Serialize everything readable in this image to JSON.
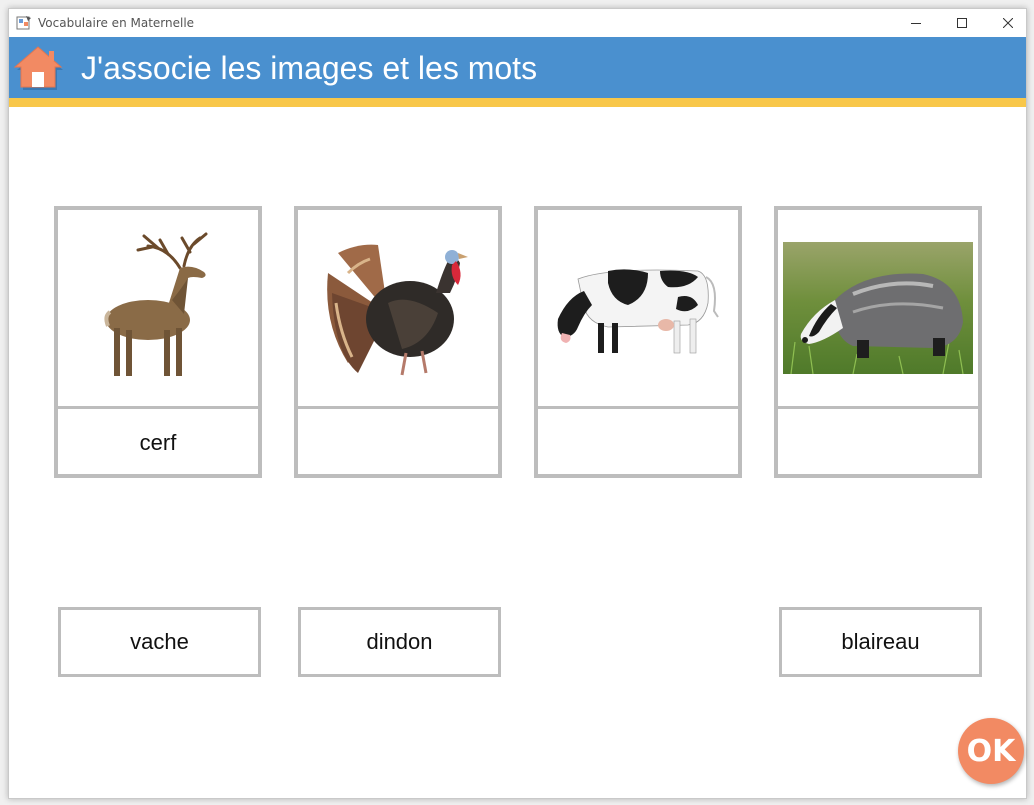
{
  "window": {
    "title": "Vocabulaire en Maternelle"
  },
  "header": {
    "title": "J'associe les images et les mots",
    "home_icon": "home-icon",
    "colors": {
      "bar": "#4a90cf",
      "stripe": "#f8c74a",
      "home": "#f28a63"
    }
  },
  "cards": [
    {
      "image": "deer-image",
      "label": "cerf"
    },
    {
      "image": "turkey-image",
      "label": ""
    },
    {
      "image": "cow-image",
      "label": ""
    },
    {
      "image": "badger-image",
      "label": ""
    }
  ],
  "words": {
    "w1": "vache",
    "w2": "dindon",
    "w3": "blaireau"
  },
  "ok_button": {
    "label": "OK",
    "color": "#f28a63"
  }
}
